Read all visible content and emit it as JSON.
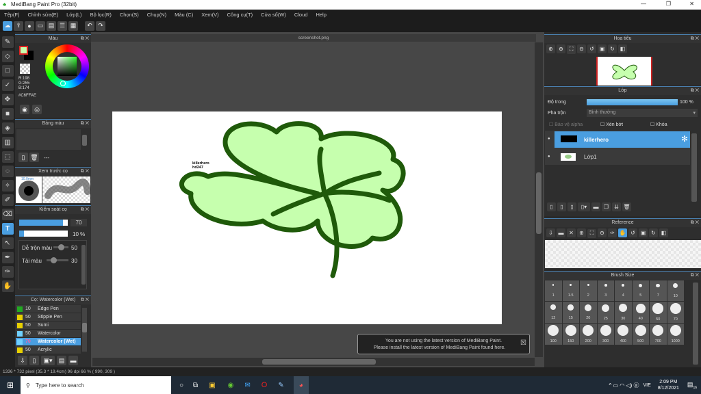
{
  "window": {
    "title": "MediBang Paint Pro (32bit)",
    "controls": [
      "minimize",
      "maximize",
      "close"
    ]
  },
  "menu": [
    "Tệp(F)",
    "Chỉnh sửa(E)",
    "Lớp(L)",
    "Bộ lọc(R)",
    "Chọn(S)",
    "Chụp(N)",
    "Màu (C)",
    "Xem(V)",
    "Công cụ(T)",
    "Cửa sổ(W)",
    "Cloud",
    "Help"
  ],
  "toolbar": {
    "icons": [
      "cloud-icon",
      "share-icon",
      "comment-icon",
      "chat-icon",
      "page-icon",
      "panel-icon",
      "grid-icon",
      "undo-icon",
      "redo-icon"
    ]
  },
  "color_panel": {
    "title": "Màu",
    "r": "R:198",
    "g": "G:255",
    "b": "B:174",
    "hex": "#C6FFAE",
    "fg": "#C6FFAE",
    "bg": "#000000"
  },
  "palette_panel": {
    "title": "Bảng màu",
    "separator": "---"
  },
  "preview_panel": {
    "title": "Xem trước cọ",
    "size_label": "10.0mm"
  },
  "brush_control": {
    "title": "Kiểm soát cọ",
    "size": "70",
    "size_fraction": 0.9,
    "opacity": "10 %",
    "opacity_fraction": 0.1,
    "blend_label": "Dễ trộn màu",
    "blend": "50",
    "blend_fraction": 0.5,
    "reload_label": "Tải màu",
    "reload": "30",
    "reload_fraction": 0.3
  },
  "brush_list": {
    "title": "Cọ: Watercolor (Wet)",
    "items": [
      {
        "size": "10",
        "name": "Edge Pen",
        "color": "#22aa22"
      },
      {
        "size": "50",
        "name": "Stipple Pen",
        "color": "#e8d000"
      },
      {
        "size": "50",
        "name": "Sumi",
        "color": "#e8d000"
      },
      {
        "size": "50",
        "name": "Watercolor",
        "color": "#6fd0ff"
      },
      {
        "size": "70",
        "name": "Watercolor (Wet)",
        "color": "#6fd0ff",
        "selected": true
      },
      {
        "size": "50",
        "name": "Acrylic",
        "color": "#e8d000"
      }
    ]
  },
  "document": {
    "tab": "screenshot.png",
    "text_line1": "killerhero",
    "text_line2": "hd247"
  },
  "notification": {
    "line1": "You are not using the latest version of MediBang Paint.",
    "line2": "Please install the latest version of MediBang Paint found here.",
    "close": "☒"
  },
  "navigator": {
    "title": "Hoa tiêu"
  },
  "layers": {
    "title": "Lớp",
    "opacity_label": "Độ trong",
    "opacity": "100 %",
    "opacity_fraction": 1.0,
    "blend_label": "Pha trộn",
    "blend": "Bình thường",
    "protect_alpha": "Bảo vệ alpha",
    "clipping": "Xén bớt",
    "lock": "Khóa",
    "items": [
      {
        "name": "killerhero",
        "selected": true
      },
      {
        "name": "Lớp1",
        "selected": false
      }
    ]
  },
  "reference": {
    "title": "Reference"
  },
  "brush_size": {
    "title": "Brush Size",
    "sizes": [
      "1",
      "1.5",
      "2",
      "3",
      "4",
      "5",
      "7",
      "10",
      "12",
      "15",
      "20",
      "25",
      "30",
      "40",
      "50",
      "70",
      "100",
      "150",
      "200",
      "300",
      "400",
      "500",
      "700",
      "1000"
    ]
  },
  "status": "1336 * 732 pixel   (35.3 * 19.4cm)   96 dpi   66 %   ( 990, 309 )",
  "taskbar": {
    "search_placeholder": "Type here to search",
    "time": "2:09 PM",
    "date": "8/12/2021",
    "lang": "VIE",
    "notifications": "16"
  }
}
